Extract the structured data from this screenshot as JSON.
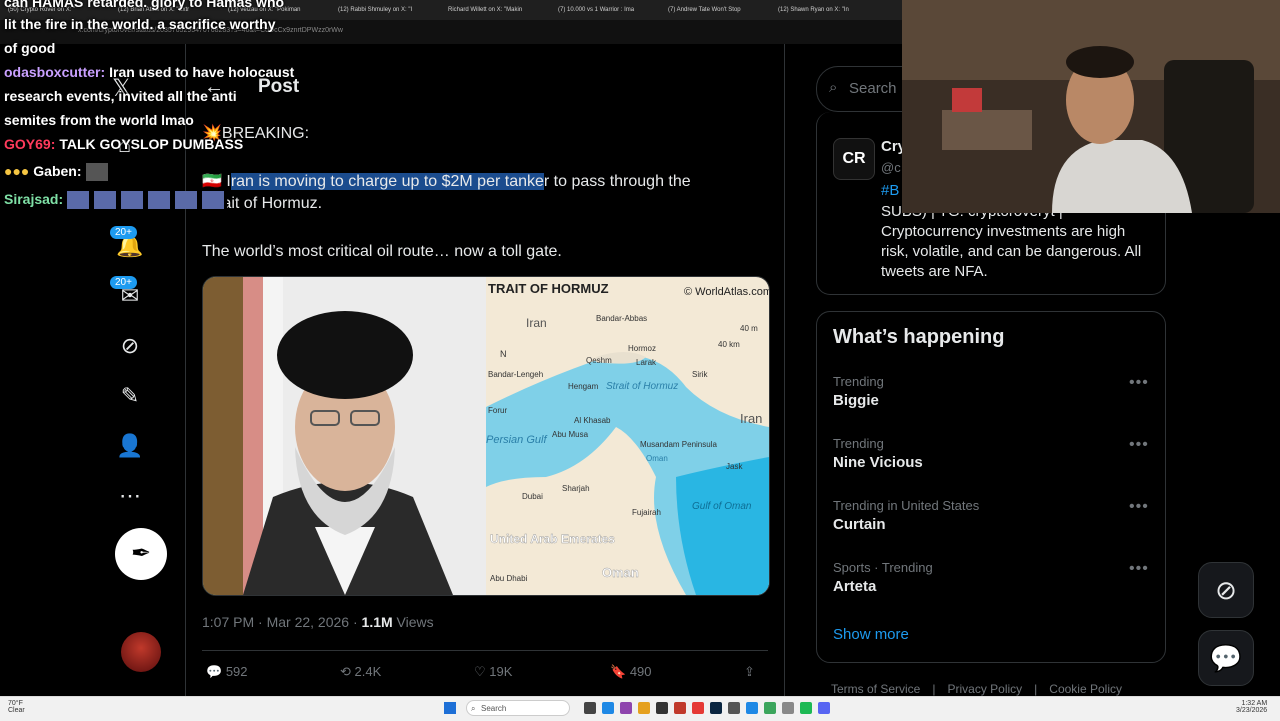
{
  "browser": {
    "tabs": [
      "(50) Crypto Rover on X: \"",
      "(12) Brian Atlas on X: \"Extr",
      "(12) velzau on X: \"Pokiman",
      "(12) Rabbi Shmuley on X: \"I",
      "Richard Willett on X: \"Makin",
      "(7) 10.000 vs 1 Warrior : Ima",
      "(7) Andrew Tate Won't Stop",
      "(12) Shawn Ryan on X: \"In"
    ],
    "url": "x.com/cryptorover/status/2035765295470768283?s=46&t=CdDcCx9znrtDPWzz0rWw"
  },
  "nav": {
    "notif_badge": "20+",
    "messages_badge": "20+"
  },
  "post": {
    "header": "Post",
    "breaking": "💥BREAKING:",
    "flag": "🇮🇷",
    "line1_pre": "I",
    "line1_hl": "ran is moving to charge up to $2M per tanke",
    "line1_post": "r to pass through the",
    "line2": "Strait of Hormuz.",
    "line3": "The world’s most critical oil route… now a toll gate.",
    "map": {
      "title": "TRAIT OF HORMUZ",
      "credit": "© WorldAtlas.com",
      "labels": {
        "iran_top": "Iran",
        "iran_right": "Iran",
        "bandar_abbas": "Bandar-Abbas",
        "hormoz": "Hormoz",
        "qeshm": "Qeshm",
        "larak": "Larak",
        "bandar_lengeh": "Bandar-Lengeh",
        "hengam": "Hengam",
        "strait": "Strait of Hormuz",
        "sirik": "Sirik",
        "forur": "Forur",
        "al_khasab": "Al Khasab",
        "abu_musa": "Abu Musa",
        "persian_gulf": "Persian Gulf",
        "musandam": "Musandam Peninsula",
        "oman_small": "Oman",
        "jask": "Jask",
        "dubai": "Dubai",
        "sharjah": "Sharjah",
        "fujairah": "Fujairah",
        "gulf_oman": "Gulf of Oman",
        "uae": "United Arab Emerates",
        "oman_big": "Oman",
        "abu_dhabi": "Abu Dhabi",
        "scale_mi": "40 m",
        "scale_km": "40 km",
        "north": "N"
      }
    },
    "time": "1:07 PM · Mar 22, 2026 · ",
    "views_count": "1.1M",
    "views_label": " Views",
    "replies": "592",
    "reposts": "2.4K",
    "likes": "19K",
    "bookmarks": "490"
  },
  "search": {
    "placeholder": "Search"
  },
  "promo": {
    "name": "Cry",
    "handle": "@c",
    "tag": "#B",
    "text": "SUBS) | TG: cryptoroveryt | Cryptocurrency investments are high risk, volatile, and can be dangerous. All tweets are NFA."
  },
  "happening": {
    "title": "What’s happening",
    "trends": [
      {
        "label": "Trending",
        "name": "Biggie"
      },
      {
        "label": "Trending",
        "name": "Nine Vicious"
      },
      {
        "label": "Trending in United States",
        "name": "Curtain"
      },
      {
        "label": "Sports · Trending",
        "name": "Arteta"
      }
    ],
    "show_more": "Show more"
  },
  "footer": {
    "terms": "Terms of Service",
    "privacy": "Privacy Policy",
    "cookie": "Cookie Policy"
  },
  "chat": [
    {
      "user": "",
      "text": "can HAMAS retarded. glory to Hamas who"
    },
    {
      "user": "",
      "text": "lit the fire in the world. a sacrifice worthy"
    },
    {
      "user": "",
      "text": "of good"
    },
    {
      "user": "odasboxcutter:",
      "text": "Iran used to have holocaust",
      "color": "#c9a0ff"
    },
    {
      "user": "",
      "text": "research events, invited all the anti"
    },
    {
      "user": "",
      "text": "semites from the world lmao"
    },
    {
      "user": "GOY69:",
      "text": "TALK GOYSLOP DUMBASS",
      "color": "#ff3b5c"
    },
    {
      "user": "Gaben:",
      "text": "",
      "color": "#ffffff"
    },
    {
      "user": "Sirajsad:",
      "text": "",
      "color": "#7fe0a6"
    }
  ],
  "taskbar": {
    "weather_temp": "70°F",
    "weather_desc": "Clear",
    "search": "Search",
    "time": "1:32 AM",
    "date": "3/23/2026"
  },
  "colors": {
    "accent": "#1d9bf0",
    "highlight": "#1b4c8e",
    "border": "#2f3336",
    "muted": "#71767b"
  }
}
